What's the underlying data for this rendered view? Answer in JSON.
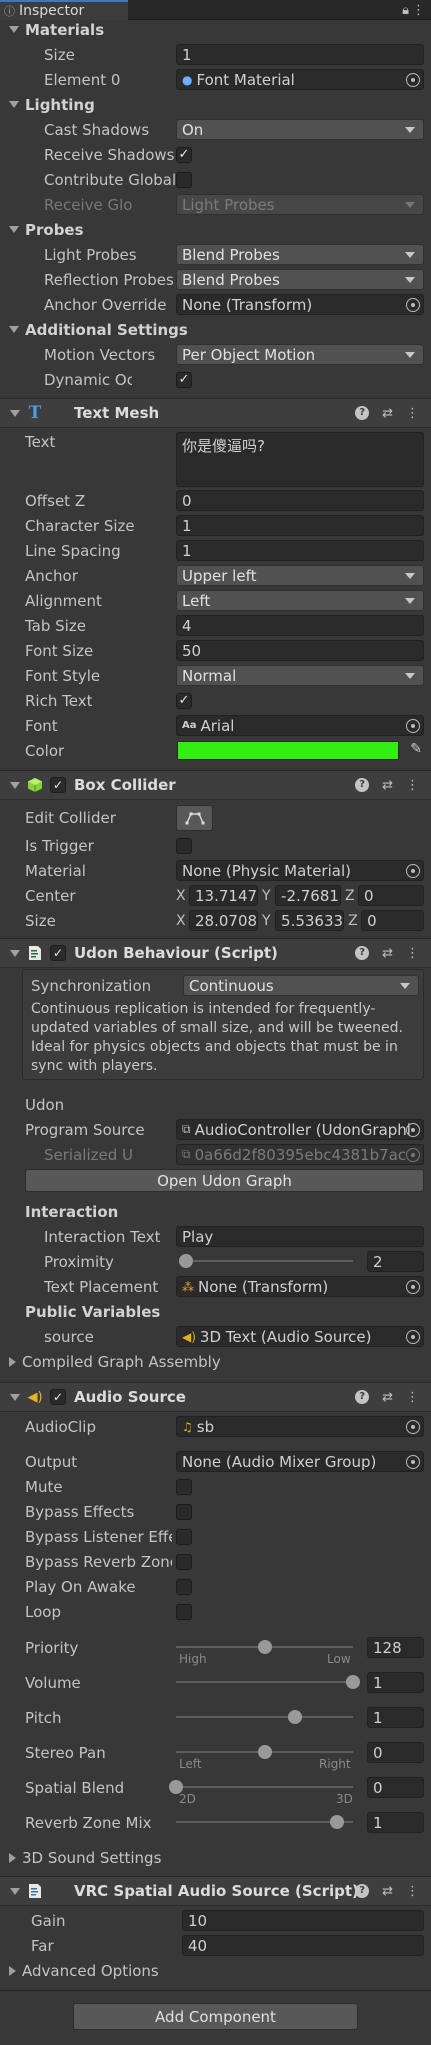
{
  "tab": {
    "title": "Inspector"
  },
  "materials": {
    "header": "Materials",
    "size_label": "Size",
    "size": "1",
    "element_label": "Element 0",
    "element_value": "Font Material"
  },
  "lighting": {
    "header": "Lighting",
    "cast_shadows_label": "Cast Shadows",
    "cast_shadows": "On",
    "receive_shadows_label": "Receive Shadows",
    "contribute_gi_label": "Contribute Global",
    "receive_gi_label": "Receive Global Illu",
    "receive_gi": "Light Probes"
  },
  "probes": {
    "header": "Probes",
    "light_probes_label": "Light Probes",
    "light_probes": "Blend Probes",
    "reflection_label": "Reflection Probes",
    "reflection": "Blend Probes",
    "anchor_label": "Anchor Override",
    "anchor": "None (Transform)"
  },
  "additional": {
    "header": "Additional Settings",
    "motion_label": "Motion Vectors",
    "motion": "Per Object Motion",
    "occlusion_label": "Dynamic Occlusic"
  },
  "text_mesh": {
    "title": "Text Mesh",
    "text_label": "Text",
    "text": "你是傻逼吗?",
    "offset_z_label": "Offset Z",
    "offset_z": "0",
    "char_size_label": "Character Size",
    "char_size": "1",
    "line_spacing_label": "Line Spacing",
    "line_spacing": "1",
    "anchor_label": "Anchor",
    "anchor": "Upper left",
    "alignment_label": "Alignment",
    "alignment": "Left",
    "tab_size_label": "Tab Size",
    "tab_size": "4",
    "font_size_label": "Font Size",
    "font_size": "50",
    "font_style_label": "Font Style",
    "font_style": "Normal",
    "rich_text_label": "Rich Text",
    "font_label": "Font",
    "font": "Arial",
    "color_label": "Color",
    "color_hex": "#33ee11"
  },
  "box_collider": {
    "title": "Box Collider",
    "edit_label": "Edit Collider",
    "trigger_label": "Is Trigger",
    "material_label": "Material",
    "material": "None (Physic Material)",
    "center_label": "Center",
    "center": {
      "x": "13.7147",
      "y": "-2.7681",
      "z": "0"
    },
    "size_label": "Size",
    "size": {
      "x": "28.0708",
      "y": "5.53633",
      "z": "0"
    },
    "axis_x": "X",
    "axis_y": "Y",
    "axis_z": "Z"
  },
  "udon": {
    "title": "Udon Behaviour (Script)",
    "sync_label": "Synchronization",
    "sync": "Continuous",
    "sync_desc": "Continuous replication is intended for frequently-updated variables of small size, and will be tweened. Ideal for physics objects and objects that must be in sync with players.",
    "udon_header": "Udon",
    "program_label": "Program Source",
    "program": "AudioController (UdonGraphl",
    "serialized_label": "Serialized Udon P",
    "serialized": "0a66d2f80395ebc4381b7ac",
    "open_graph": "Open Udon Graph",
    "interaction_header": "Interaction",
    "interaction_text_label": "Interaction Text",
    "interaction_text": "Play",
    "proximity_label": "Proximity",
    "proximity": 2,
    "proximity_max": 100,
    "placement_label": "Text Placement",
    "placement": "None (Transform)",
    "public_header": "Public Variables",
    "source_label": "source",
    "source": "3D Text (Audio Source)",
    "compiled_label": "Compiled Graph Assembly"
  },
  "audio": {
    "title": "Audio Source",
    "clip_label": "AudioClip",
    "clip": "sb",
    "output_label": "Output",
    "output": "None (Audio Mixer Group)",
    "mute_label": "Mute",
    "bypass_effects_label": "Bypass Effects",
    "bypass_listener_label": "Bypass Listener Effe",
    "bypass_reverb_label": "Bypass Reverb Zone",
    "play_on_awake_label": "Play On Awake",
    "loop_label": "Loop",
    "priority_label": "Priority",
    "priority": "128",
    "priority_fraction": 0.5,
    "high_label": "High",
    "low_label": "Low",
    "volume_label": "Volume",
    "volume": "1",
    "volume_fraction": 1.0,
    "pitch_label": "Pitch",
    "pitch": "1",
    "pitch_fraction": 0.67,
    "pan_label": "Stereo Pan",
    "pan": "0",
    "pan_fraction": 0.5,
    "left_label": "Left",
    "right_label": "Right",
    "blend_label": "Spatial Blend",
    "blend": "0",
    "blend_fraction": 0.0,
    "twod_label": "2D",
    "threed_label": "3D",
    "reverb_label": "Reverb Zone Mix",
    "reverb": "1",
    "reverb_fraction": 0.91,
    "sound_settings_label": "3D Sound Settings"
  },
  "vrc": {
    "title": "VRC Spatial Audio Source (Script)",
    "gain_label": "Gain",
    "gain": "10",
    "far_label": "Far",
    "far": "40",
    "advanced_label": "Advanced Options"
  },
  "add_component": "Add Component"
}
